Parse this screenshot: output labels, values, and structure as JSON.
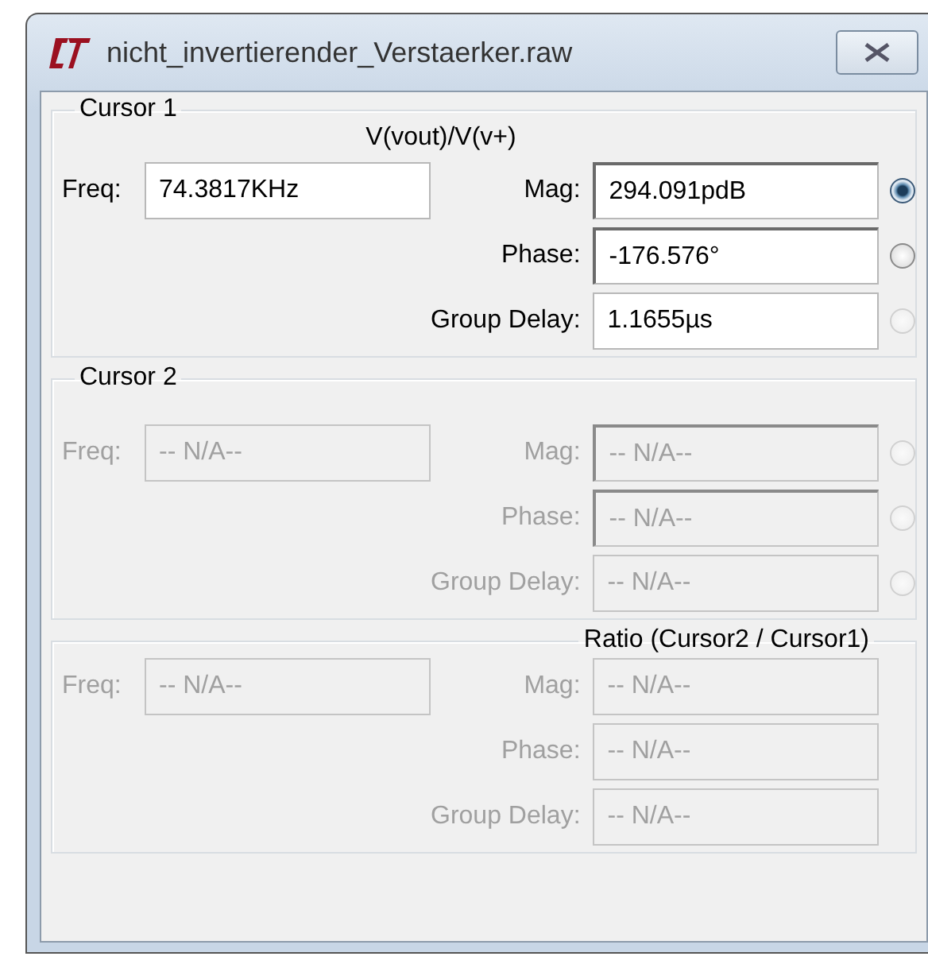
{
  "window": {
    "title": "nicht_invertierender_Verstaerker.raw"
  },
  "groups": [
    {
      "kind": "cursor",
      "title": "Cursor 1",
      "trace": "V(vout)/V(v+)",
      "disabled": false,
      "fields": [
        {
          "label": "Freq:",
          "value": "74.3817KHz",
          "editable": false
        },
        {
          "label": "Mag:",
          "value": "294.091pdB",
          "editable": true,
          "radio": {
            "selected": true,
            "disabled": false
          }
        },
        {
          "label": "Phase:",
          "value": "-176.576°",
          "editable": true,
          "radio": {
            "selected": false,
            "disabled": false
          }
        },
        {
          "label": "Group Delay:",
          "value": "1.1655µs",
          "editable": false,
          "radio": {
            "selected": false,
            "disabled": true
          }
        }
      ]
    },
    {
      "kind": "cursor",
      "title": "Cursor 2",
      "disabled": true,
      "fields": [
        {
          "label": "Freq:",
          "value": "-- N/A--",
          "editable": false
        },
        {
          "label": "Mag:",
          "value": "-- N/A--",
          "editable": true,
          "radio": {
            "selected": false,
            "disabled": true
          }
        },
        {
          "label": "Phase:",
          "value": "-- N/A--",
          "editable": true,
          "radio": {
            "selected": false,
            "disabled": true
          }
        },
        {
          "label": "Group Delay:",
          "value": "-- N/A--",
          "editable": false,
          "radio": {
            "selected": false,
            "disabled": true
          }
        }
      ]
    },
    {
      "kind": "ratio",
      "title": "Ratio (Cursor2 / Cursor1)",
      "disabled": true,
      "fields": [
        {
          "label": "Freq:",
          "value": "-- N/A--",
          "editable": false
        },
        {
          "label": "Mag:",
          "value": "-- N/A--",
          "editable": false
        },
        {
          "label": "Phase:",
          "value": "-- N/A--",
          "editable": false
        },
        {
          "label": "Group Delay:",
          "value": "-- N/A--",
          "editable": false
        }
      ]
    }
  ]
}
